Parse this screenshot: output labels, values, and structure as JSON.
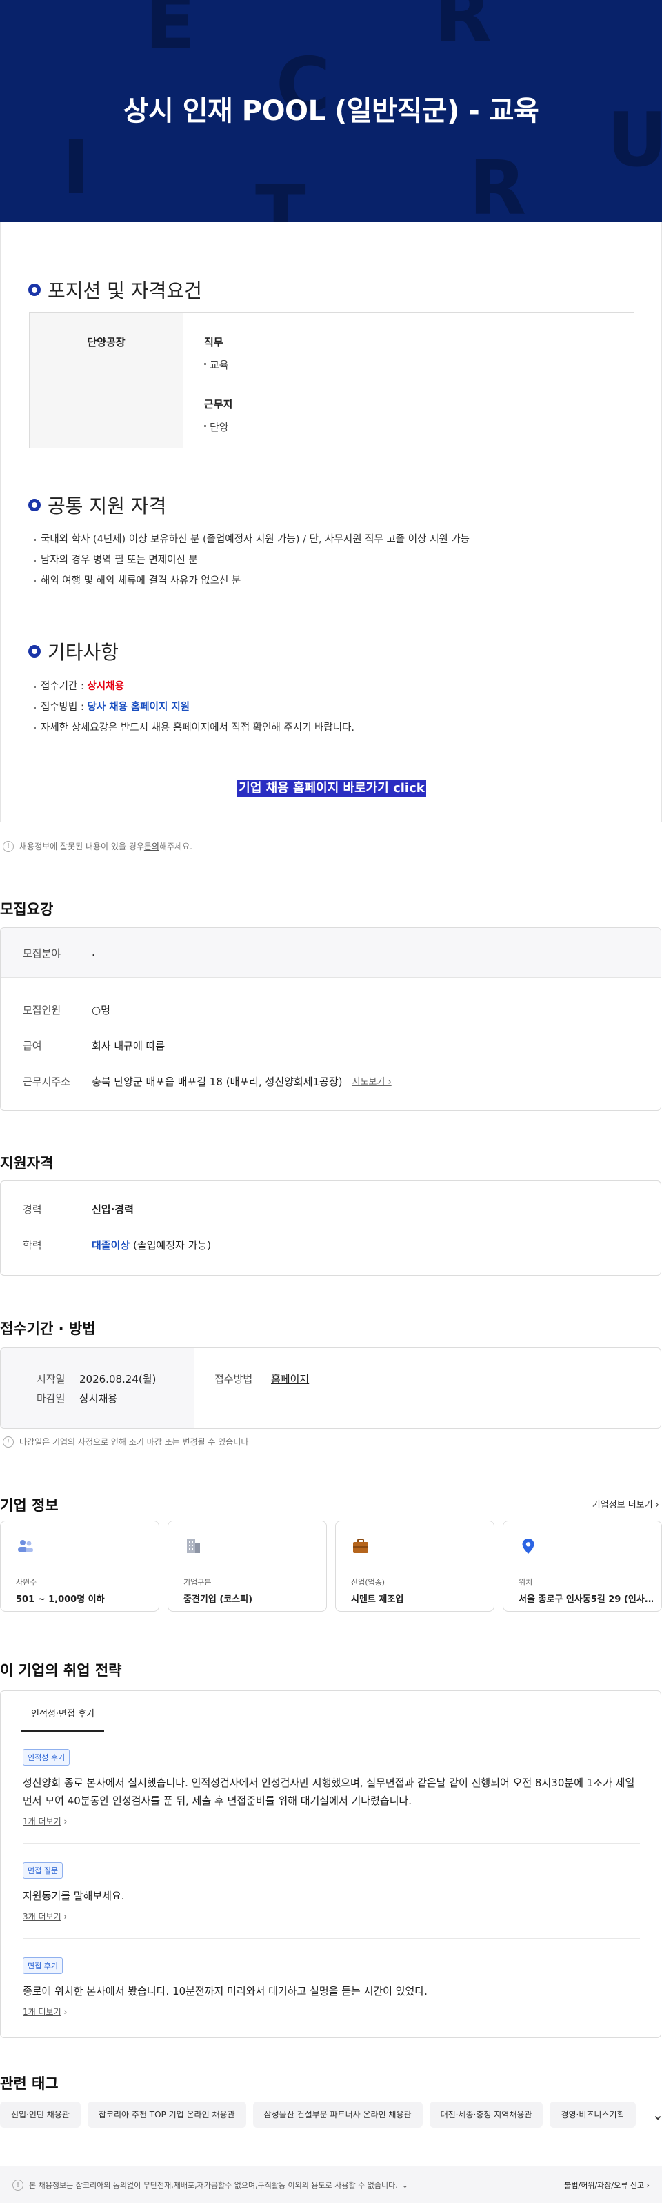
{
  "hero": {
    "title": "상시 인재 POOL (일반직군) - 교육",
    "bg_color": "#08226a"
  },
  "sections": {
    "position": {
      "title": "포지션 및 자격요건",
      "location_name": "단양공장",
      "job_label": "직무",
      "job_value": "교육",
      "workplace_label": "근무지",
      "workplace_value": "단양"
    },
    "common": {
      "title": "공통 지원 자격",
      "items": [
        "국내외 학사 (4년제) 이상 보유하신 분 (졸업예정자 지원 가능) / 단, 사무지원 직무 고졸 이상 지원 가능",
        "남자의 경우 병역 필 또는 면제이신 분",
        "해외 여행 및 해외 체류에 결격 사유가 없으신 분"
      ]
    },
    "etc": {
      "title": "기타사항",
      "period_label": "접수기간 : ",
      "period_value": "상시채용",
      "method_label": "접수방법 : ",
      "method_value": "당사 채용 홈페이지 지원",
      "note": "자세한 상세요강은 반드시 채용 홈페이지에서 직접 확인해 주시기 바랍니다."
    },
    "cta_label": "기업 채용 홈페이지 바로가기 click"
  },
  "notice1": {
    "text": "채용정보에 잘못된 내용이 있을 경우 ",
    "link": "문의",
    "suffix": "해주세요."
  },
  "recruit": {
    "title": "모집요강",
    "field_label": "모집분야",
    "field_value": ".",
    "count_label": "모집인원",
    "count_value": "○명",
    "salary_label": "급여",
    "salary_value": "회사 내규에 따름",
    "addr_label": "근무지주소",
    "addr_value": "충북 단양군 매포읍 매포길 18 (매포리, 성신양회제1공장)",
    "map_link": "지도보기"
  },
  "qual": {
    "title": "지원자격",
    "career_label": "경력",
    "career_value": "신입·경력",
    "edu_label": "학력",
    "edu_value": "대졸이상",
    "edu_note": " (졸업예정자 가능)"
  },
  "apply": {
    "title": "접수기간 · 방법",
    "start_label": "시작일",
    "start_value": "2026.08.24(월)",
    "end_label": "마감일",
    "end_value": "상시채용",
    "method_label": "접수방법",
    "method_value": "홈페이지",
    "notice": "마감일은 기업의 사정으로 인해 조기 마감 또는 변경될 수 있습니다"
  },
  "company": {
    "title": "기업 정보",
    "more": "기업정보 더보기",
    "cards": [
      {
        "label": "사원수",
        "value": "501 ~ 1,000명 이하",
        "icon": "people-icon"
      },
      {
        "label": "기업구분",
        "value": "중견기업 (코스피)",
        "icon": "building-icon"
      },
      {
        "label": "산업(업종)",
        "value": "시멘트 제조업",
        "icon": "briefcase-icon"
      },
      {
        "label": "위치",
        "value": "서울 종로구 인사동5길 29 (인사...",
        "icon": "location-pin-icon"
      }
    ]
  },
  "strategy": {
    "title": "이 기업의 취업 전략",
    "tab": "인적성·면접 후기",
    "reviews": [
      {
        "chip": "인적성 후기",
        "text": "성신양회 종로 본사에서 실시했습니다. 인적성검사에서 인성검사만 시행했으며, 실무면접과 같은날 같이 진행되어 오전 8시30분에 1조가 제일 먼저 모여 40분동안 인성검사를 푼 뒤, 제출 후 면접준비를 위해 대기실에서 기다렸습니다.",
        "more": "1개 더보기"
      },
      {
        "chip": "면접 질문",
        "text": "지원동기를 말해보세요.",
        "more": "3개 더보기"
      },
      {
        "chip": "면접 후기",
        "text": "종로에 위치한 본사에서 봤습니다. 10분전까지 미리와서 대기하고 설명을 듣는 시간이 있었다.",
        "more": "1개 더보기"
      }
    ]
  },
  "tags": {
    "title": "관련 태그",
    "items": [
      "신입·인턴 채용관",
      "잡코리아 추천 TOP 기업 온라인 채용관",
      "삼성물산 건설부문 파트너사 온라인 채용관",
      "대전·세종·충청 지역채용관",
      "경영·비즈니스기획"
    ]
  },
  "footer": {
    "left": "본 채용정보는 잡코리아의 동의없이 무단전재,재배포,재가공할수 없으며,구직활동 이외의 용도로 사용할 수 없습니다.",
    "right": "불법/허위/과장/오류 신고"
  }
}
